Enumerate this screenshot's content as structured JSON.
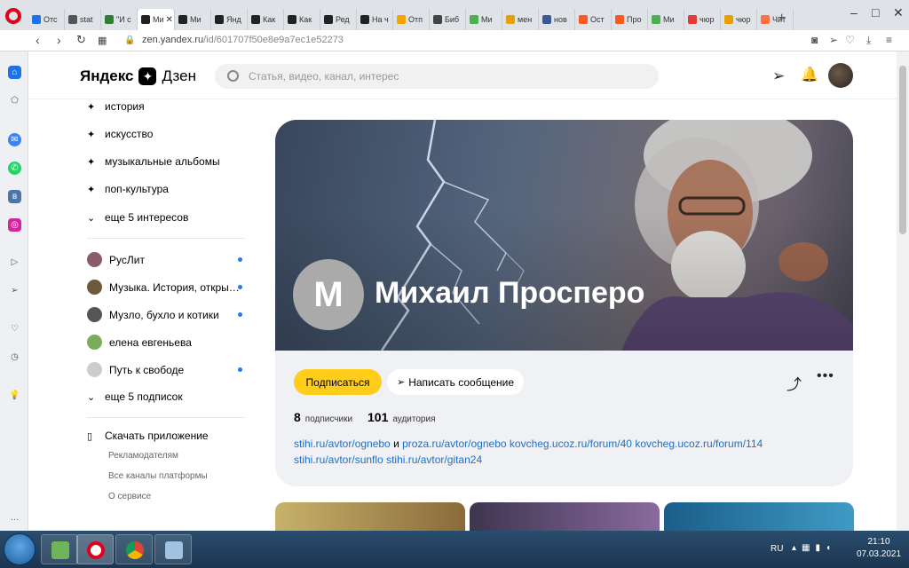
{
  "browser": {
    "tabs": [
      {
        "label": "Отс",
        "fav_color": "#1a73e8"
      },
      {
        "label": "stat",
        "fav_color": "#555555"
      },
      {
        "label": "\"И с",
        "fav_color": "#2e7d32"
      },
      {
        "label": "Ми",
        "fav_color": "#222222",
        "active": true
      },
      {
        "label": "Ми",
        "fav_color": "#222222"
      },
      {
        "label": "Янд",
        "fav_color": "#222222"
      },
      {
        "label": "Как",
        "fav_color": "#222222"
      },
      {
        "label": "Как",
        "fav_color": "#222222"
      },
      {
        "label": "Ред",
        "fav_color": "#222222"
      },
      {
        "label": "На ч",
        "fav_color": "#222222"
      },
      {
        "label": "Отп",
        "fav_color": "#f4a300"
      },
      {
        "label": "Биб",
        "fav_color": "#444444"
      },
      {
        "label": "Ми",
        "fav_color": "#4caf50"
      },
      {
        "label": "мен",
        "fav_color": "#e6a100"
      },
      {
        "label": "нов",
        "fav_color": "#3b5998"
      },
      {
        "label": "Ост",
        "fav_color": "#ff5722"
      },
      {
        "label": "Про",
        "fav_color": "#ff5722"
      },
      {
        "label": "Ми",
        "fav_color": "#4caf50"
      },
      {
        "label": "чюр",
        "fav_color": "#e53935"
      },
      {
        "label": "чюр",
        "fav_color": "#e6a100"
      },
      {
        "label": "Чит",
        "fav_color": "#ff7043"
      }
    ],
    "close_symbol": "✕",
    "new_tab_symbol": "+",
    "url_host": "zen.yandex.ru",
    "url_path": "/id/601707f50e8e9a7ec1e52273",
    "window_controls": [
      "–",
      "□",
      "✕"
    ]
  },
  "header": {
    "logo_yandex": "Яндекс",
    "logo_star": "✦",
    "logo_dzen": "Дзен",
    "search_placeholder": "Статья, видео, канал, интерес"
  },
  "sidebar": {
    "interests": [
      {
        "label": "история"
      },
      {
        "label": "искусство"
      },
      {
        "label": "музыкальные альбомы"
      },
      {
        "label": "поп-культура"
      }
    ],
    "more_interests": "еще 5 интересов",
    "subscriptions": [
      {
        "label": "РусЛит",
        "avatar_color": "#8b5a6b",
        "dot": true
      },
      {
        "label": "Музыка. История, откры…",
        "avatar_color": "#6d5a3a",
        "dot": true
      },
      {
        "label": "Музло, бухло и котики",
        "avatar_color": "#555555",
        "dot": true
      },
      {
        "label": "елена евгеньева",
        "avatar_color": "#7cab5a",
        "dot": false
      },
      {
        "label": "Путь к свободе",
        "avatar_color": "#cccccc",
        "dot": true
      }
    ],
    "more_subscriptions": "еще 5 подписок",
    "download_app": "Скачать приложение",
    "footer_links": [
      "Рекламодателям",
      "Все каналы платформы",
      "О сервисе"
    ]
  },
  "channel": {
    "avatar_letter": "M",
    "name": "Михаил Просперо",
    "subscribe_label": "Подписаться",
    "message_label": "Написать сообщение",
    "subscribers_count": "8",
    "subscribers_label": "подписчики",
    "audience_count": "101",
    "audience_label": "аудитория",
    "links_line1": [
      "stihi.ru/avtor/ognebo",
      "и",
      "proza.ru/avtor/ognebo",
      "kovcheg.ucoz.ru/forum/40",
      "kovcheg.ucoz.ru/forum/114"
    ],
    "links_line2": [
      "stihi.ru/avtor/sunflo",
      "stihi.ru/avtor/gitan24"
    ]
  },
  "taskbar": {
    "lang": "RU",
    "time": "21:10",
    "date": "07.03.2021"
  }
}
